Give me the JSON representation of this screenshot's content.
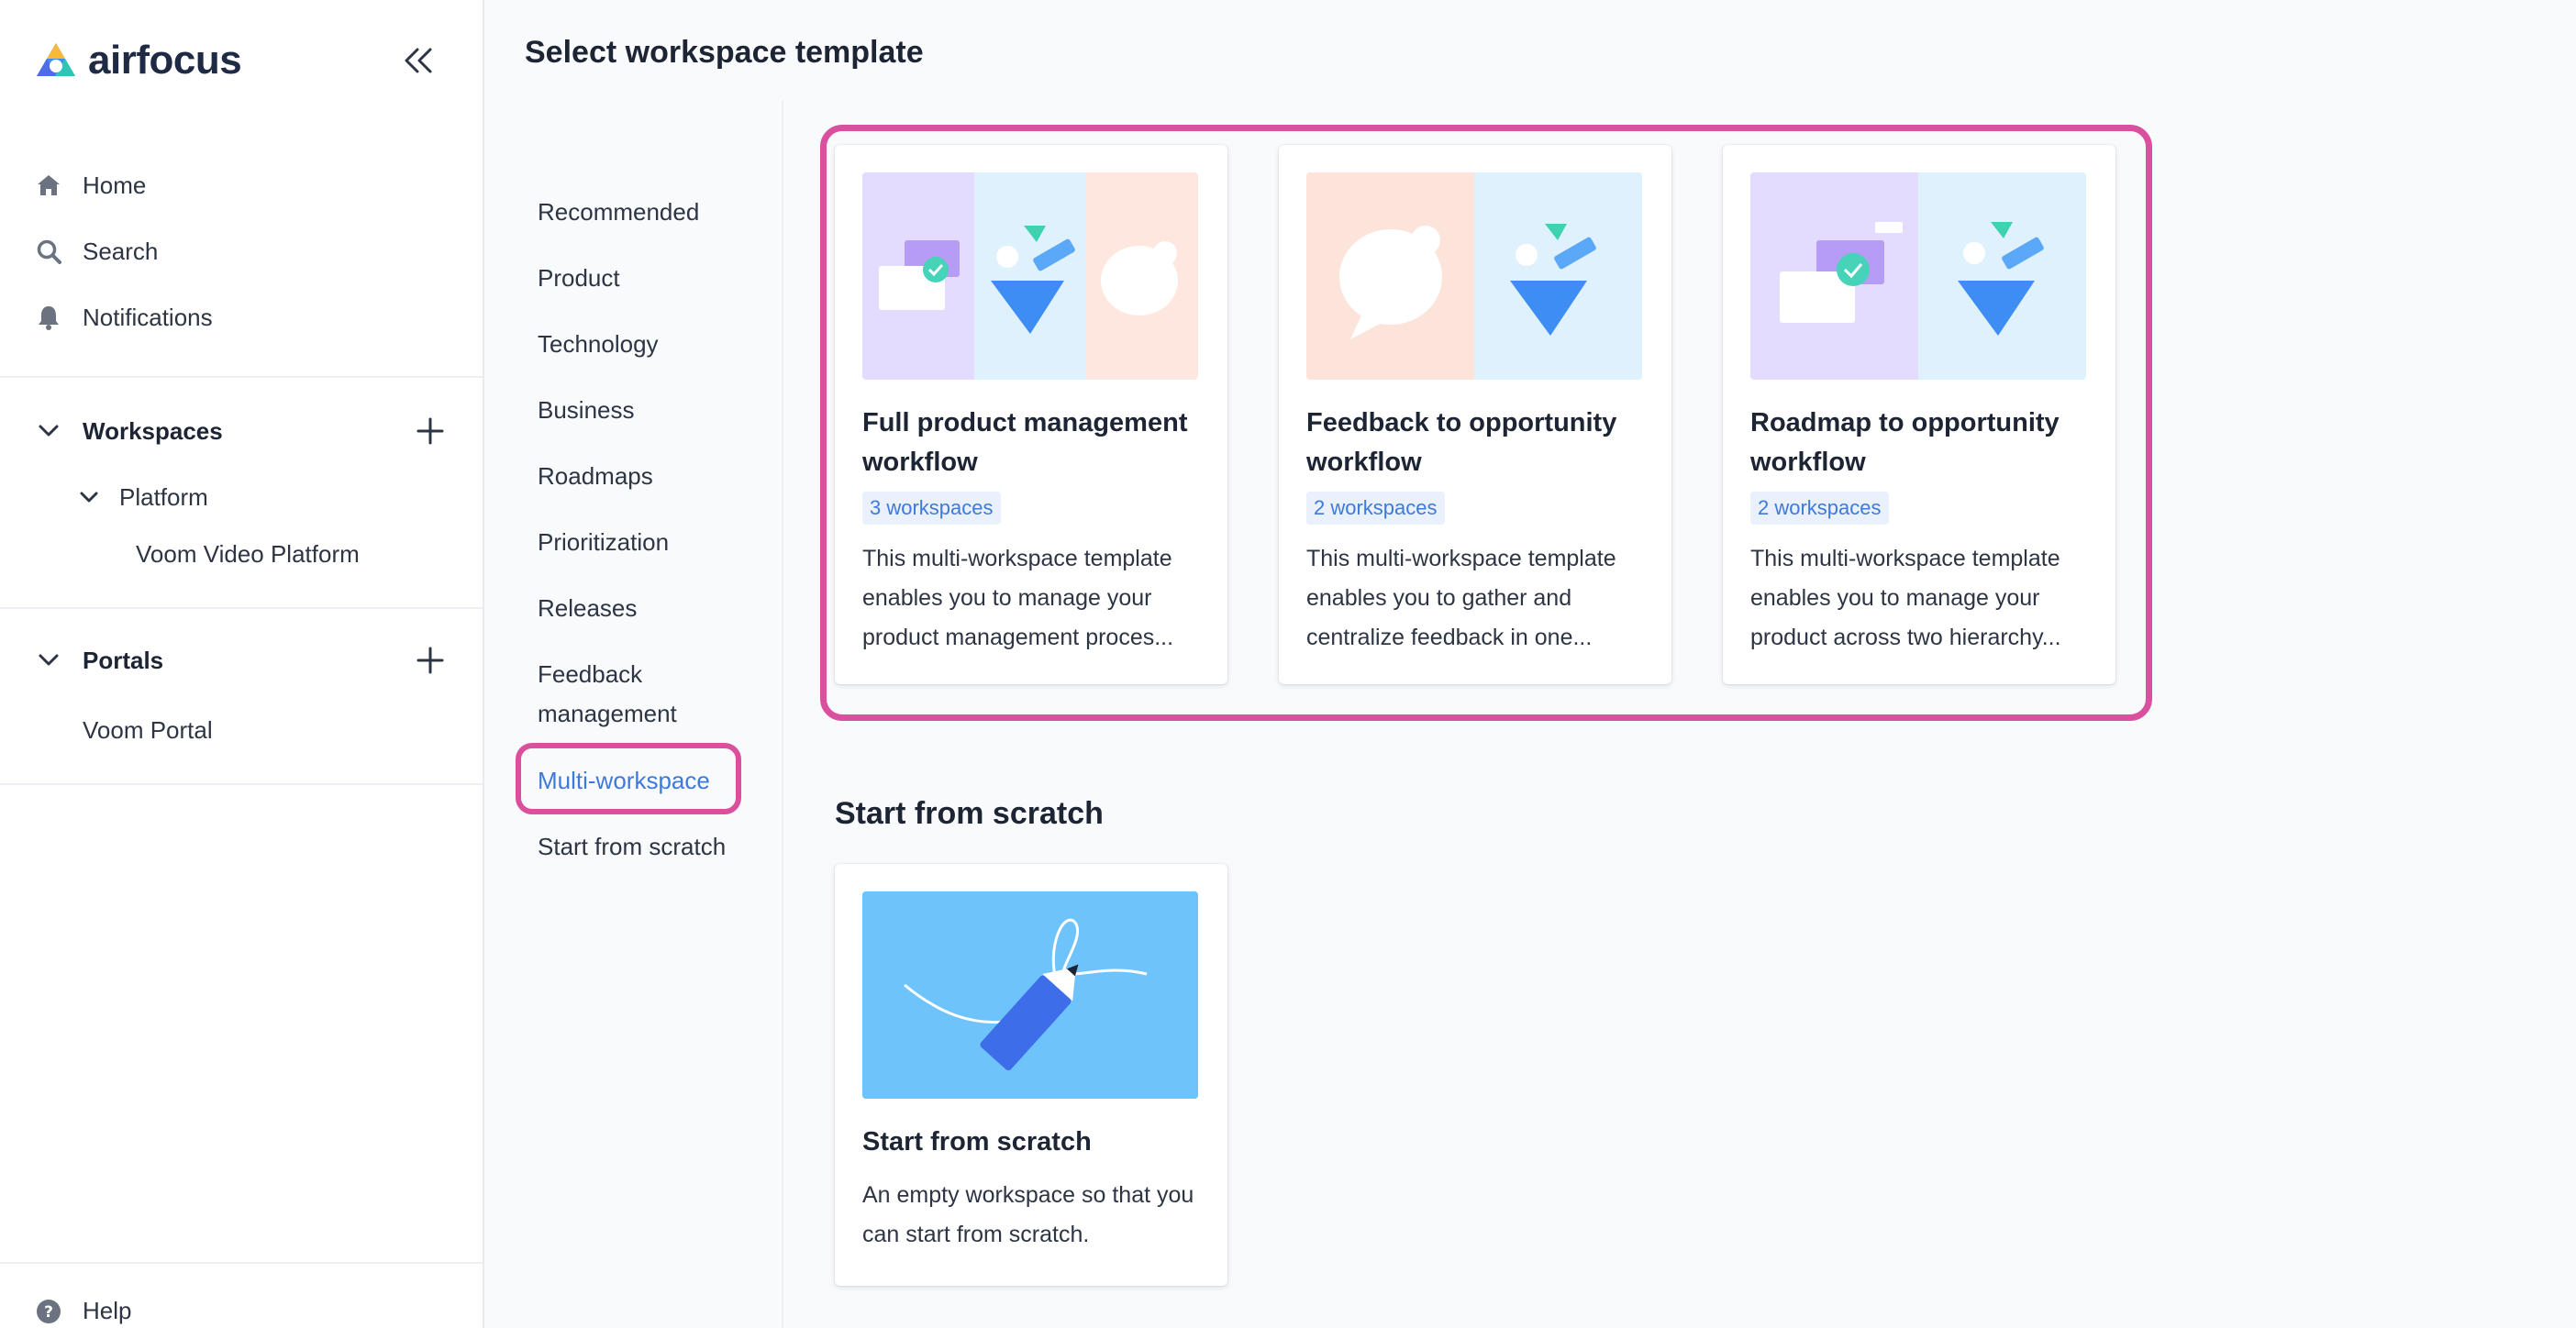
{
  "app": {
    "name": "airfocus"
  },
  "sidebar": {
    "nav": [
      {
        "label": "Home",
        "icon": "home-icon"
      },
      {
        "label": "Search",
        "icon": "search-icon"
      },
      {
        "label": "Notifications",
        "icon": "bell-icon"
      }
    ],
    "workspaces": {
      "label": "Workspaces",
      "folder": "Platform",
      "items": [
        "Voom Video Platform"
      ]
    },
    "portals": {
      "label": "Portals",
      "items": [
        "Voom Portal"
      ]
    },
    "help_label": "Help"
  },
  "main": {
    "title": "Select workspace template",
    "categories": [
      "Recommended",
      "Product",
      "Technology",
      "Business",
      "Roadmaps",
      "Prioritization",
      "Releases",
      "Feedback\nmanagement",
      "Multi-workspace",
      "Start from scratch"
    ],
    "active_category": "Multi-workspace",
    "templates": [
      {
        "title": "Full product management workflow",
        "badge": "3 workspaces",
        "description": "This multi-workspace template enables you to manage your product management proces..."
      },
      {
        "title": "Feedback to opportunity workflow",
        "badge": "2 workspaces",
        "description": "This multi-workspace template enables you to gather and centralize feedback in one..."
      },
      {
        "title": "Roadmap to opportunity workflow",
        "badge": "2 workspaces",
        "description": "This multi-workspace template enables you to manage your product across two hierarchy..."
      }
    ],
    "scratch_section": {
      "heading": "Start from scratch",
      "card": {
        "title": "Start from scratch",
        "description": "An empty workspace so that you can start from scratch."
      }
    }
  },
  "colors": {
    "accent": "#3d7ad9",
    "highlight": "#d9519e",
    "badge_bg": "#eaf1fc",
    "scratch_thumb": "#6fc3fb"
  }
}
